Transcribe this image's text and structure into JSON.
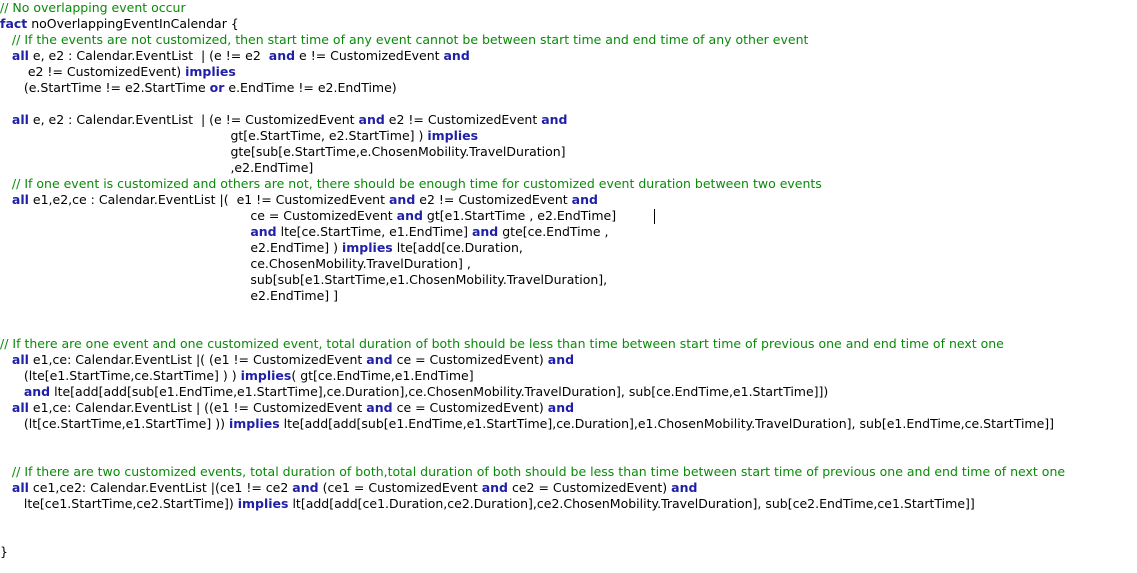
{
  "editor": {
    "colors": {
      "background": "#ffffff",
      "comment": "#0a8a0a",
      "keyword": "#1f1fa8",
      "text": "#000000"
    },
    "lines": [
      [
        {
          "t": "c",
          "s": "// No overlapping event occur"
        }
      ],
      [
        {
          "t": "k",
          "s": "fact"
        },
        {
          "t": "n",
          "s": " noOverlappingEventInCalendar {"
        }
      ],
      [
        {
          "t": "n",
          "s": "   "
        },
        {
          "t": "c",
          "s": "// If the events are not customized, then start time of any event cannot be between start time and end time of any other event"
        }
      ],
      [
        {
          "t": "n",
          "s": "   "
        },
        {
          "t": "k",
          "s": "all"
        },
        {
          "t": "n",
          "s": " e, e2 : Calendar.EventList  | (e != e2  "
        },
        {
          "t": "k",
          "s": "and"
        },
        {
          "t": "n",
          "s": " e != CustomizedEvent "
        },
        {
          "t": "k",
          "s": "and"
        }
      ],
      [
        {
          "t": "n",
          "s": "       e2 != CustomizedEvent) "
        },
        {
          "t": "k",
          "s": "implies"
        }
      ],
      [
        {
          "t": "n",
          "s": "      (e.StartTime != e2.StartTime "
        },
        {
          "t": "k",
          "s": "or"
        },
        {
          "t": "n",
          "s": " e.EndTime != e2.EndTime)"
        }
      ],
      [],
      [
        {
          "t": "n",
          "s": "   "
        },
        {
          "t": "k",
          "s": "all"
        },
        {
          "t": "n",
          "s": " e, e2 : Calendar.EventList  | (e != CustomizedEvent "
        },
        {
          "t": "k",
          "s": "and"
        },
        {
          "t": "n",
          "s": " e2 != CustomizedEvent "
        },
        {
          "t": "k",
          "s": "and"
        }
      ],
      [
        {
          "t": "n",
          "s": "                                                          gt[e.StartTime, e2.StartTime] ) "
        },
        {
          "t": "k",
          "s": "implies"
        }
      ],
      [
        {
          "t": "n",
          "s": "                                                          gte[sub[e.StartTime,e.ChosenMobility.TravelDuration]"
        }
      ],
      [
        {
          "t": "n",
          "s": "                                                          ,e2.EndTime]"
        }
      ],
      [
        {
          "t": "n",
          "s": "   "
        },
        {
          "t": "c",
          "s": "// If one event is customized and others are not, there should be enough time for customized event duration between two events"
        }
      ],
      [
        {
          "t": "n",
          "s": "   "
        },
        {
          "t": "k",
          "s": "all"
        },
        {
          "t": "n",
          "s": " e1,e2,ce : Calendar.EventList |(  e1 != CustomizedEvent "
        },
        {
          "t": "k",
          "s": "and"
        },
        {
          "t": "n",
          "s": " e2 != CustomizedEvent "
        },
        {
          "t": "k",
          "s": "and"
        }
      ],
      [
        {
          "t": "n",
          "s": "                                                               ce = CustomizedEvent "
        },
        {
          "t": "k",
          "s": "and"
        },
        {
          "t": "n",
          "s": " gt[e1.StartTime , e2.EndTime]"
        }
      ],
      [
        {
          "t": "n",
          "s": "                                                               "
        },
        {
          "t": "k",
          "s": "and"
        },
        {
          "t": "n",
          "s": " lte[ce.StartTime, e1.EndTime] "
        },
        {
          "t": "k",
          "s": "and"
        },
        {
          "t": "n",
          "s": " gte[ce.EndTime ,"
        }
      ],
      [
        {
          "t": "n",
          "s": "                                                               e2.EndTime] ) "
        },
        {
          "t": "k",
          "s": "implies"
        },
        {
          "t": "n",
          "s": " lte[add[ce.Duration,"
        }
      ],
      [
        {
          "t": "n",
          "s": "                                                               ce.ChosenMobility.TravelDuration] ,"
        }
      ],
      [
        {
          "t": "n",
          "s": "                                                               sub[sub[e1.StartTime,e1.ChosenMobility.TravelDuration],"
        }
      ],
      [
        {
          "t": "n",
          "s": "                                                               e2.EndTime] ]"
        }
      ],
      [],
      [],
      [
        {
          "t": "c",
          "s": "// If there are one event and one customized event, total duration of both should be less than time between start time of previous one and end time of next one"
        }
      ],
      [
        {
          "t": "n",
          "s": "   "
        },
        {
          "t": "k",
          "s": "all"
        },
        {
          "t": "n",
          "s": " e1,ce: Calendar.EventList |( (e1 != CustomizedEvent "
        },
        {
          "t": "k",
          "s": "and"
        },
        {
          "t": "n",
          "s": " ce = CustomizedEvent) "
        },
        {
          "t": "k",
          "s": "and"
        }
      ],
      [
        {
          "t": "n",
          "s": "      (lte[e1.StartTime,ce.StartTime] ) ) "
        },
        {
          "t": "k",
          "s": "implies"
        },
        {
          "t": "n",
          "s": "( gt[ce.EndTime,e1.EndTime]"
        }
      ],
      [
        {
          "t": "n",
          "s": "      "
        },
        {
          "t": "k",
          "s": "and"
        },
        {
          "t": "n",
          "s": " lte[add[add[sub[e1.EndTime,e1.StartTime],ce.Duration],ce.ChosenMobility.TravelDuration], sub[ce.EndTime,e1.StartTime]])"
        }
      ],
      [
        {
          "t": "n",
          "s": "   "
        },
        {
          "t": "k",
          "s": "all"
        },
        {
          "t": "n",
          "s": " e1,ce: Calendar.EventList | ((e1 != CustomizedEvent "
        },
        {
          "t": "k",
          "s": "and"
        },
        {
          "t": "n",
          "s": " ce = CustomizedEvent) "
        },
        {
          "t": "k",
          "s": "and"
        }
      ],
      [
        {
          "t": "n",
          "s": "      (lt[ce.StartTime,e1.StartTime] )) "
        },
        {
          "t": "k",
          "s": "implies"
        },
        {
          "t": "n",
          "s": " lte[add[add[sub[e1.EndTime,e1.StartTime],ce.Duration],e1.ChosenMobility.TravelDuration], sub[e1.EndTime,ce.StartTime]]"
        }
      ],
      [],
      [],
      [
        {
          "t": "n",
          "s": "   "
        },
        {
          "t": "c",
          "s": "// If there are two customized events, total duration of both,total duration of both should be less than time between start time of previous one and end time of next one"
        }
      ],
      [
        {
          "t": "n",
          "s": "   "
        },
        {
          "t": "k",
          "s": "all"
        },
        {
          "t": "n",
          "s": " ce1,ce2: Calendar.EventList |(ce1 != ce2 "
        },
        {
          "t": "k",
          "s": "and"
        },
        {
          "t": "n",
          "s": " (ce1 = CustomizedEvent "
        },
        {
          "t": "k",
          "s": "and"
        },
        {
          "t": "n",
          "s": " ce2 = CustomizedEvent) "
        },
        {
          "t": "k",
          "s": "and"
        }
      ],
      [
        {
          "t": "n",
          "s": "      lte[ce1.StartTime,ce2.StartTime]) "
        },
        {
          "t": "k",
          "s": "implies"
        },
        {
          "t": "n",
          "s": " lt[add[add[ce1.Duration,ce2.Duration],ce2.ChosenMobility.TravelDuration], sub[ce2.EndTime,ce1.StartTime]]"
        }
      ],
      [],
      [],
      [
        {
          "t": "n",
          "s": "}"
        }
      ]
    ]
  }
}
